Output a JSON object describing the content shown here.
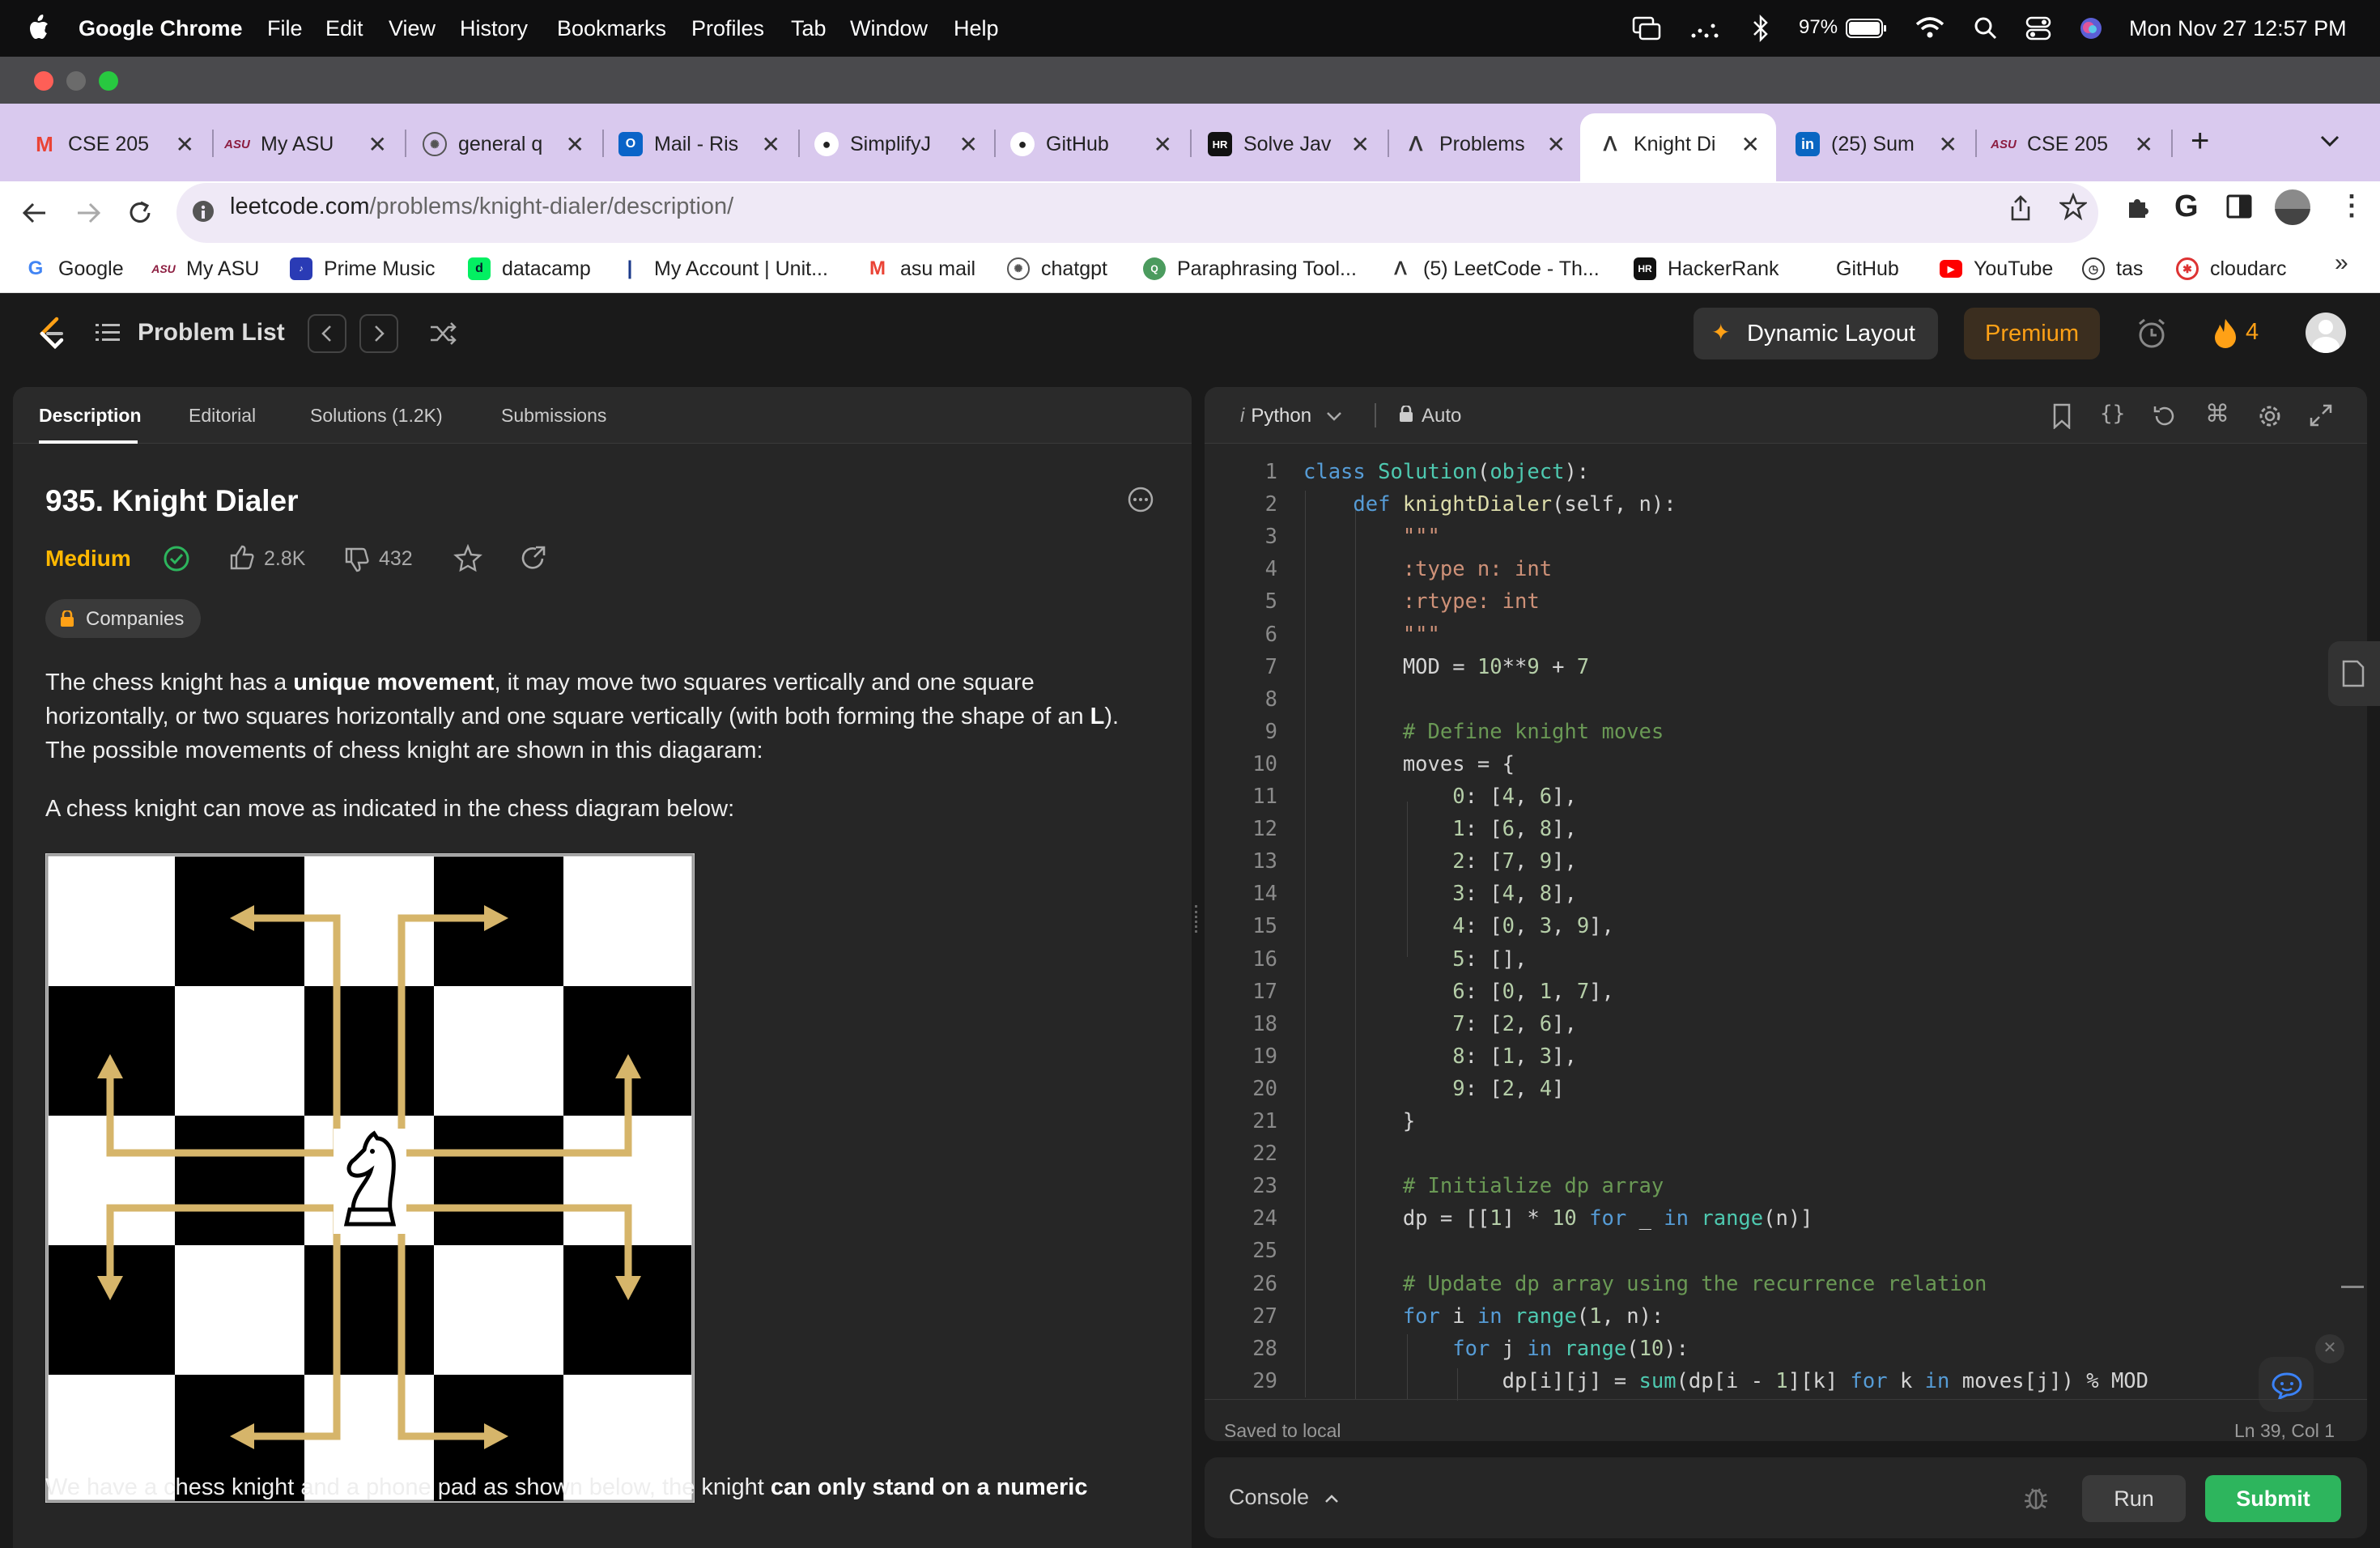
{
  "menubar": {
    "app": "Google Chrome",
    "items": [
      "File",
      "Edit",
      "View",
      "History",
      "Bookmarks",
      "Profiles",
      "Tab",
      "Window",
      "Help"
    ],
    "battery": "97%",
    "datetime": "Mon Nov 27  12:57 PM"
  },
  "tabs": [
    {
      "title": "CSE 205",
      "icon": "gmail-icon"
    },
    {
      "title": "My ASU",
      "icon": "asu-icon"
    },
    {
      "title": "general q",
      "icon": "chatgpt-icon"
    },
    {
      "title": "Mail - Ris",
      "icon": "outlook-icon"
    },
    {
      "title": "SimplifyJ",
      "icon": "github-icon"
    },
    {
      "title": "GitHub",
      "icon": "github-icon"
    },
    {
      "title": "Solve Jav",
      "icon": "hackerrank-icon"
    },
    {
      "title": "Problems",
      "icon": "leetcode-icon"
    },
    {
      "title": "Knight Di",
      "icon": "leetcode-icon",
      "active": true
    },
    {
      "title": "(25) Sum",
      "icon": "linkedin-icon"
    },
    {
      "title": "CSE 205",
      "icon": "asu-icon"
    }
  ],
  "omnibox": {
    "host": "leetcode.com",
    "path": "/problems/knight-dialer/description/"
  },
  "bookmarks": [
    {
      "label": "Google",
      "icon": "google-icon"
    },
    {
      "label": "My ASU",
      "icon": "asu-icon"
    },
    {
      "label": "Prime Music",
      "icon": "prime-music-icon"
    },
    {
      "label": "datacamp",
      "icon": "datacamp-icon"
    },
    {
      "label": "My Account | Unit...",
      "icon": "bookmark-icon"
    },
    {
      "label": "asu mail",
      "icon": "gmail-icon"
    },
    {
      "label": "chatgpt",
      "icon": "chatgpt-icon"
    },
    {
      "label": "Paraphrasing Tool...",
      "icon": "quillbot-icon"
    },
    {
      "label": "(5) LeetCode - Th...",
      "icon": "leetcode-icon"
    },
    {
      "label": "HackerRank",
      "icon": "hackerrank-icon"
    },
    {
      "label": "GitHub",
      "icon": "github-icon"
    },
    {
      "label": "YouTube",
      "icon": "youtube-icon"
    },
    {
      "label": "tas",
      "icon": "clock-icon"
    },
    {
      "label": "cloudarc",
      "icon": "cloud-icon"
    }
  ],
  "lc_header": {
    "problem_list": "Problem List",
    "dynamic_layout": "Dynamic Layout",
    "premium": "Premium",
    "streak": "4"
  },
  "left": {
    "tabs": [
      "Description",
      "Editorial",
      "Solutions (1.2K)",
      "Submissions"
    ],
    "title": "935. Knight Dialer",
    "difficulty": "Medium",
    "likes": "2.8K",
    "dislikes": "432",
    "companies": "Companies",
    "p1_a": "The chess knight has a ",
    "p1_b": "unique movement",
    "p1_c": ", it may move two squares vertically and one square",
    "p1_d": "horizontally, or two squares horizontally and one square vertically (with both forming the shape of an ",
    "p1_e": "L",
    "p1_f": ").",
    "p1_g": "The possible movements of chess knight are shown in this diagaram:",
    "p2": "A chess knight can move as indicated in the chess diagram below:",
    "p3_a": "We have a chess knight and a phone pad as shown below, the knight ",
    "p3_b": "can only stand on a numeric"
  },
  "editor": {
    "language": "Python",
    "mode": "Auto",
    "lines": [
      "class Solution(object):",
      "    def knightDialer(self, n):",
      "        \"\"\"",
      "        :type n: int",
      "        :rtype: int",
      "        \"\"\"",
      "        MOD = 10**9 + 7",
      "",
      "        # Define knight moves",
      "        moves = {",
      "            0: [4, 6],",
      "            1: [6, 8],",
      "            2: [7, 9],",
      "            3: [4, 8],",
      "            4: [0, 3, 9],",
      "            5: [],",
      "            6: [0, 1, 7],",
      "            7: [2, 6],",
      "            8: [1, 3],",
      "            9: [2, 4]",
      "        }",
      "",
      "        # Initialize dp array",
      "        dp = [[1] * 10 for _ in range(n)]",
      "",
      "        # Update dp array using the recurrence relation",
      "        for i in range(1, n):",
      "            for j in range(10):",
      "                dp[i][j] = sum(dp[i - 1][k] for k in moves[j]) % MOD"
    ],
    "status_left": "Saved to local",
    "status_right": "Ln 39, Col 1"
  },
  "console": {
    "label": "Console",
    "run": "Run",
    "submit": "Submit"
  },
  "colors": {
    "accent_green": "#2db55d",
    "medium": "#ffb800",
    "premium": "#ffa116",
    "arrow": "#d6b56a"
  }
}
